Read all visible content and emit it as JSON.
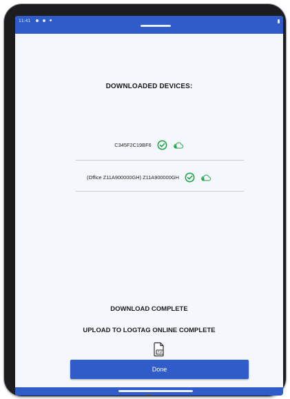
{
  "status_bar": {
    "time": "11:41",
    "icons": [
      "settings-icon",
      "sim-icon",
      "signal-icon",
      "battery-icon"
    ]
  },
  "screen": {
    "title": "DOWNLOADED DEVICES:",
    "devices": [
      {
        "label": "C345F2C19BF6",
        "downloaded_icon": "check-circle-icon",
        "upload_icon": "cloud-icon"
      },
      {
        "label": "(Office Z11A900000GH) Z11A900000GH",
        "downloaded_icon": "check-circle-icon",
        "upload_icon": "cloud-icon"
      }
    ],
    "download_status": "DOWNLOAD COMPLETE",
    "upload_status": "UPLOAD TO LOGTAG ONLINE COMPLETE",
    "report_icon": "pdf-document-icon",
    "done_label": "Done"
  },
  "colors": {
    "accent": "#2f5cc8",
    "check_green": "#1ea64a",
    "cloud_green": "#1ea64a",
    "background": "#f4f7fb"
  }
}
